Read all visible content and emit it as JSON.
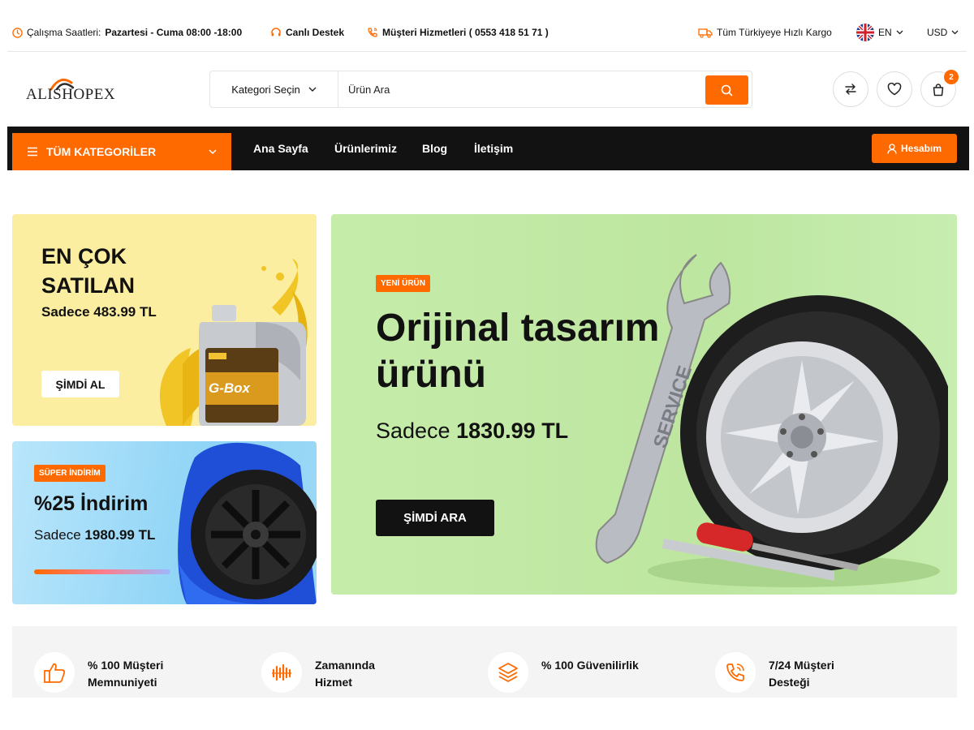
{
  "topbar": {
    "hours_label": "Çalışma Saatleri:",
    "hours_value": "Pazartesi - Cuma 08:00 -18:00",
    "live_support": "Canlı Destek",
    "customer_service": "Müşteri Hizmetleri ( 0553 418 51 71 )",
    "shipping": "Tüm Türkiyeye Hızlı Kargo",
    "language": "EN",
    "currency": "USD"
  },
  "header": {
    "logo_text": "ALISHOPEX",
    "category_select": "Kategori Seçin",
    "search_placeholder": "Ürün Ara",
    "cart_count": "2"
  },
  "nav": {
    "all_categories": "TÜM KATEGORİLER",
    "links": [
      "Ana Sayfa",
      "Ürünlerimiz",
      "Blog",
      "İletişim"
    ],
    "account": "Hesabım"
  },
  "banners": {
    "best_seller": {
      "title": "EN ÇOK SATILAN",
      "price": "Sadece 483.99 TL",
      "button": "ŞİMDİ AL"
    },
    "discount": {
      "badge": "SÜPER İNDİRİM",
      "title": "%25 İndirim",
      "price_prefix": "Sadece",
      "price": "1980.99 TL"
    },
    "main": {
      "badge": "YENİ ÜRÜN",
      "title": "Orijinal tasarım ürünü",
      "price_prefix": "Sadece",
      "price": "1830.99 TL",
      "button": "ŞİMDİ ARA"
    }
  },
  "features": [
    {
      "label": "% 100 Müşteri Memnuniyeti",
      "icon": "thumbs-up-icon"
    },
    {
      "label": "Zamanında Hizmet",
      "icon": "timely-service-icon"
    },
    {
      "label": "% 100 Güvenilirlik",
      "icon": "layers-icon"
    },
    {
      "label": "7/24 Müşteri Desteği",
      "icon": "phone-call-icon"
    }
  ],
  "colors": {
    "accent": "#ff6a00",
    "nav_bg": "#121212"
  }
}
